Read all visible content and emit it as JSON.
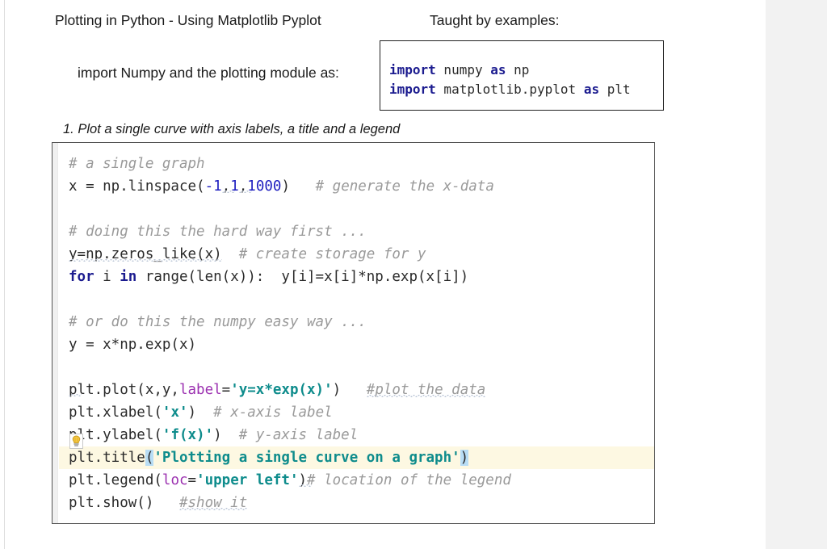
{
  "document": {
    "title": "Plotting in Python - Using Matplotlib Pyplot",
    "taught_by": "Taught by examples:",
    "import_caption": "import Numpy and the plotting module as:",
    "section_heading": "1. Plot a single curve with axis labels, a title and a legend"
  },
  "import_box": {
    "line1": {
      "kw_import": "import",
      "module": " numpy ",
      "kw_as": "as",
      "alias": " np"
    },
    "line2": {
      "kw_import": "import",
      "module": " matplotlib.pyplot ",
      "kw_as": "as",
      "alias": " plt"
    }
  },
  "code": {
    "l1_comment": "# a single graph",
    "l2_a": "x = np.linspace(",
    "l2_n1": "-1",
    "l2_c1": ",",
    "l2_n2": "1",
    "l2_c2": ",",
    "l2_n3": "1000",
    "l2_b": ")",
    "l2_comment": "# generate the x-data",
    "l4_comment": "# doing this the hard way first ...",
    "l5_code": "y=np.zeros_like(x)",
    "l5_comment": "# create storage for y",
    "l6_kw1": "for",
    "l6_mid": " i ",
    "l6_kw2": "in",
    "l6_rest": " range(len(x)):  y[i]=x[i]*np.exp(x[i])",
    "l8_comment": "# or do this the numpy easy way ...",
    "l9_code": "y = x*np.exp(x)",
    "l11_a": "plt.plot(x,y,",
    "l11_kwarg": "label",
    "l11_eq": "=",
    "l11_str": "'y=x*exp(x)'",
    "l11_b": ")",
    "l11_comment": "#plot the data",
    "l12_a": "plt.xlabel(",
    "l12_str": "'x'",
    "l12_b": ")",
    "l12_comment": "# x-axis label",
    "l13_a": "plt.ylabel(",
    "l13_str": "'f(x)'",
    "l13_b": ")",
    "l13_comment": "# y-axis label",
    "l14_a": "plt.title",
    "l14_open": "(",
    "l14_str": "'Plotting a single curve on a graph'",
    "l14_close": ")",
    "l15_a": "plt.legend(",
    "l15_kwarg": "loc",
    "l15_eq": "=",
    "l15_str": "'upper left'",
    "l15_b": ")",
    "l15_comment": "# location of the legend",
    "l16_code": "plt.show()",
    "l16_comment": "#show it"
  },
  "icons": {
    "intention_bulb": "lightbulb-icon"
  },
  "colors": {
    "keyword": "#1b1b8f",
    "number": "#2020c0",
    "string": "#0e8c8c",
    "kwarg": "#9b30b0",
    "comment": "#9a9a9a",
    "line_highlight": "#fdf8e2",
    "paren_match": "#b8ddf5",
    "right_panel": "#f2f2f2"
  }
}
